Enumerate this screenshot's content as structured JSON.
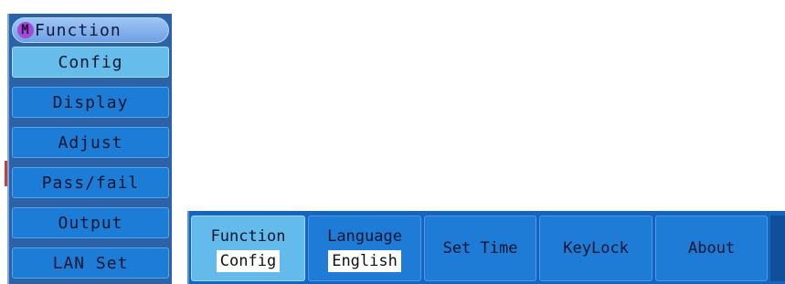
{
  "function_menu": {
    "badge": "M",
    "title": "Function",
    "items": [
      {
        "label": "Config",
        "selected": true
      },
      {
        "label": "Display",
        "selected": false
      },
      {
        "label": "Adjust",
        "selected": false
      },
      {
        "label": "Pass/fail",
        "selected": false
      },
      {
        "label": "Output",
        "selected": false
      },
      {
        "label": "LAN Set",
        "selected": false
      }
    ]
  },
  "soft_keys": [
    {
      "title": "Function",
      "value": "Config",
      "active": true
    },
    {
      "title": "Language",
      "value": "English",
      "active": false
    },
    {
      "title": "Set Time",
      "value": "",
      "active": false
    },
    {
      "title": "KeyLock",
      "value": "",
      "active": false
    },
    {
      "title": "About",
      "value": "",
      "active": false
    }
  ],
  "colors": {
    "menu_bg": "#2c63a8",
    "item_bg": "#1c7cd6",
    "item_selected_bg": "#66bdec",
    "badge": "#a349d6"
  }
}
